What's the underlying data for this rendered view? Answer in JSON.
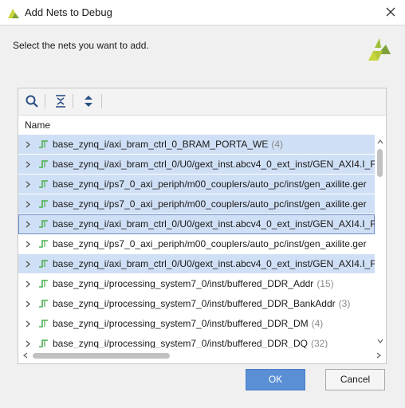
{
  "window": {
    "title": "Add Nets to Debug",
    "app_icon": "vivado-logo-icon",
    "close_icon": "close-icon"
  },
  "instruction": "Select the nets you want to add.",
  "toolbar": {
    "buttons": [
      "search-icon",
      "collapse-all-icon",
      "expand-all-icon"
    ]
  },
  "table": {
    "column_header": "Name",
    "rows": [
      {
        "name": "base_zynq_i/axi_bram_ctrl_0_BRAM_PORTA_WE",
        "count": "(4)",
        "selected": true
      },
      {
        "name": "base_zynq_i/axi_bram_ctrl_0/U0/gext_inst.abcv4_0_ext_inst/GEN_AXI4.I_F",
        "count": "",
        "selected": true
      },
      {
        "name": "base_zynq_i/ps7_0_axi_periph/m00_couplers/auto_pc/inst/gen_axilite.ger",
        "count": "",
        "selected": true
      },
      {
        "name": "base_zynq_i/ps7_0_axi_periph/m00_couplers/auto_pc/inst/gen_axilite.ger",
        "count": "",
        "selected": true
      },
      {
        "name": "base_zynq_i/axi_bram_ctrl_0/U0/gext_inst.abcv4_0_ext_inst/GEN_AXI4.I_F",
        "count": "",
        "selected": true,
        "focused": true
      },
      {
        "name": "base_zynq_i/ps7_0_axi_periph/m00_couplers/auto_pc/inst/gen_axilite.ger",
        "count": "",
        "selected": false
      },
      {
        "name": "base_zynq_i/axi_bram_ctrl_0/U0/gext_inst.abcv4_0_ext_inst/GEN_AXI4.I_F",
        "count": "",
        "selected": true
      },
      {
        "name": "base_zynq_i/processing_system7_0/inst/buffered_DDR_Addr",
        "count": "(15)",
        "selected": false
      },
      {
        "name": "base_zynq_i/processing_system7_0/inst/buffered_DDR_BankAddr",
        "count": "(3)",
        "selected": false
      },
      {
        "name": "base_zynq_i/processing_system7_0/inst/buffered_DDR_DM",
        "count": "(4)",
        "selected": false
      },
      {
        "name": "base_zynq_i/processing_system7_0/inst/buffered_DDR_DQ",
        "count": "(32)",
        "selected": false
      }
    ]
  },
  "buttons": {
    "ok": "OK",
    "cancel": "Cancel"
  },
  "colors": {
    "selection": "#cfdff5",
    "primary_button": "#5a8fd6",
    "net_icon": "#4caf50"
  }
}
